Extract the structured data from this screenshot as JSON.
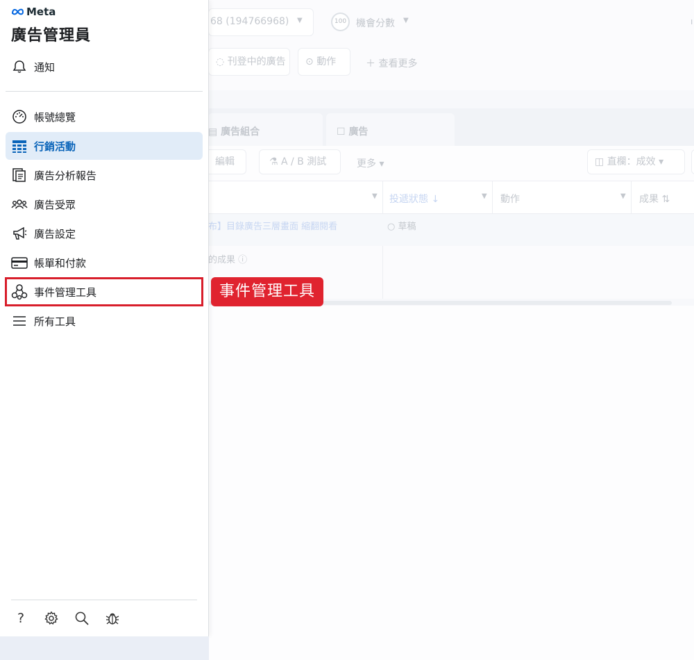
{
  "brand": {
    "name": "Meta"
  },
  "app_title": "廣告管理員",
  "notifications": {
    "label": "通知"
  },
  "nav": {
    "items": [
      {
        "label": "帳號總覽",
        "icon": "dashboard-gauge-icon"
      },
      {
        "label": "行銷活動",
        "icon": "table-grid-icon",
        "active": true
      },
      {
        "label": "廣告分析報告",
        "icon": "report-pages-icon"
      },
      {
        "label": "廣告受眾",
        "icon": "audience-people-icon"
      },
      {
        "label": "廣告設定",
        "icon": "megaphone-icon"
      },
      {
        "label": "帳單和付款",
        "icon": "credit-card-icon"
      },
      {
        "label": "事件管理工具",
        "icon": "event-nodes-icon",
        "highlighted": true
      },
      {
        "label": "所有工具",
        "icon": "hamburger-menu-icon"
      }
    ]
  },
  "footer": {
    "icons": [
      "help-icon",
      "settings-gear-icon",
      "search-icon",
      "bug-report-icon"
    ],
    "help_glyph": "?"
  },
  "callout": {
    "text": "事件管理工具"
  },
  "background": {
    "account_id": "68 (194766968)",
    "score_value": "100",
    "score_label": "機會分數",
    "filter_live_ads": "刊登中的廣告",
    "actions": "動作",
    "see_more": "查看更多",
    "tab_adsets": "廣告組合",
    "tab_ads": "廣告",
    "edit": "編輯",
    "ab_test": "A / B 測試",
    "more": "更多",
    "columns": "直欄：成效",
    "col_delivery": "投遞狀態",
    "col_actions": "動作",
    "col_results": "成果",
    "row_campaign": "布】目錄廣告三層畫面 縮翻閱看",
    "row_status": "草稿",
    "results_note": "的成果"
  },
  "colors": {
    "accent_blue": "#0a64b9",
    "active_bg": "#e1ecf8",
    "highlight_red": "#d81e2b",
    "callout_red": "#e0232f"
  }
}
